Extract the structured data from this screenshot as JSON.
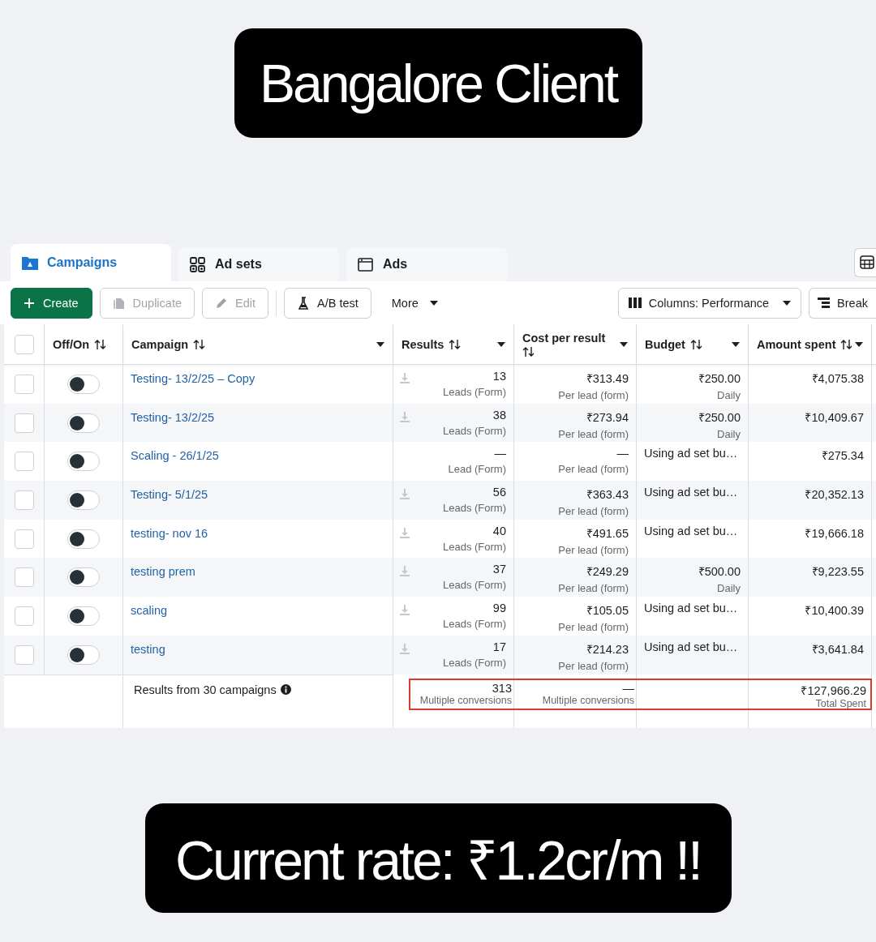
{
  "top_caption": "Bangalore Client",
  "tabs": [
    {
      "label": "Campaigns",
      "selected": true
    },
    {
      "label": "Ad sets",
      "selected": false
    },
    {
      "label": "Ads",
      "selected": false
    }
  ],
  "toolbar": {
    "buttons": [
      {
        "label": "Create",
        "kind": "primary",
        "disabled": false
      },
      {
        "label": "Duplicate",
        "kind": "default",
        "disabled": true
      },
      {
        "label": "Edit",
        "kind": "default",
        "disabled": true
      },
      {
        "label": "A/B test",
        "kind": "default",
        "disabled": false
      },
      {
        "label": "More",
        "kind": "menu",
        "disabled": false
      }
    ],
    "right_buttons": [
      {
        "label": "Columns: Performance",
        "menu": true
      },
      {
        "label": "Break",
        "menu": false
      }
    ]
  },
  "table": {
    "select_all_checked": false,
    "columns": [
      {
        "label": "Off/On",
        "menu": false
      },
      {
        "label": "Campaign",
        "menu": true
      },
      {
        "label": "Results",
        "menu": true
      },
      {
        "label": "Cost per result",
        "menu": true
      },
      {
        "label": "Budget",
        "menu": true
      },
      {
        "label": "Amount spent",
        "menu": true
      }
    ],
    "rows": [
      {
        "checked": false,
        "on": false,
        "campaign": "Testing- 13/2/25 – Copy",
        "download_icon": true,
        "results": "13",
        "results_label": "Leads (Form)",
        "cost": "₹313.49",
        "cost_label": "Per lead (form)",
        "budget": "₹250.00",
        "budget_label": "Daily",
        "amount": "₹4,075.38"
      },
      {
        "checked": false,
        "on": false,
        "campaign": "Testing- 13/2/25",
        "download_icon": true,
        "results": "38",
        "results_label": "Leads (Form)",
        "cost": "₹273.94",
        "cost_label": "Per lead (form)",
        "budget": "₹250.00",
        "budget_label": "Daily",
        "amount": "₹10,409.67"
      },
      {
        "checked": false,
        "on": false,
        "campaign": "Scaling - 26/1/25",
        "download_icon": false,
        "results": "—",
        "results_label": "Lead (Form)",
        "cost": "—",
        "cost_label": "Per lead (form)",
        "budget": "Using ad set bu…",
        "amount": "₹275.34"
      },
      {
        "checked": false,
        "on": false,
        "campaign": "Testing- 5/1/25",
        "download_icon": true,
        "results": "56",
        "results_label": "Leads (Form)",
        "cost": "₹363.43",
        "cost_label": "Per lead (form)",
        "budget": "Using ad set bu…",
        "amount": "₹20,352.13"
      },
      {
        "checked": false,
        "on": false,
        "campaign": "testing- nov 16",
        "download_icon": true,
        "results": "40",
        "results_label": "Leads (Form)",
        "cost": "₹491.65",
        "cost_label": "Per lead (form)",
        "budget": "Using ad set bu…",
        "amount": "₹19,666.18"
      },
      {
        "checked": false,
        "on": false,
        "campaign": "testing prem",
        "download_icon": true,
        "results": "37",
        "results_label": "Leads (Form)",
        "cost": "₹249.29",
        "cost_label": "Per lead (form)",
        "budget": "₹500.00",
        "budget_label": "Daily",
        "amount": "₹9,223.55"
      },
      {
        "checked": false,
        "on": false,
        "campaign": "scaling",
        "download_icon": true,
        "results": "99",
        "results_label": "Leads (Form)",
        "cost": "₹105.05",
        "cost_label": "Per lead (form)",
        "budget": "Using ad set bu…",
        "amount": "₹10,400.39"
      },
      {
        "checked": false,
        "on": false,
        "campaign": "testing",
        "download_icon": true,
        "results": "17",
        "results_label": "Leads (Form)",
        "cost": "₹214.23",
        "cost_label": "Per lead (form)",
        "budget": "Using ad set bu…",
        "amount": "₹3,641.84"
      }
    ],
    "footer": {
      "summary": "Results from 30 campaigns",
      "results": "313",
      "results_label": "Multiple conversions",
      "cost": "—",
      "cost_label": "Multiple conversions",
      "amount": "₹127,966.29",
      "amount_label": "Total Spent"
    }
  },
  "bottom_caption": "Current rate: ₹1.2cr/m !!"
}
